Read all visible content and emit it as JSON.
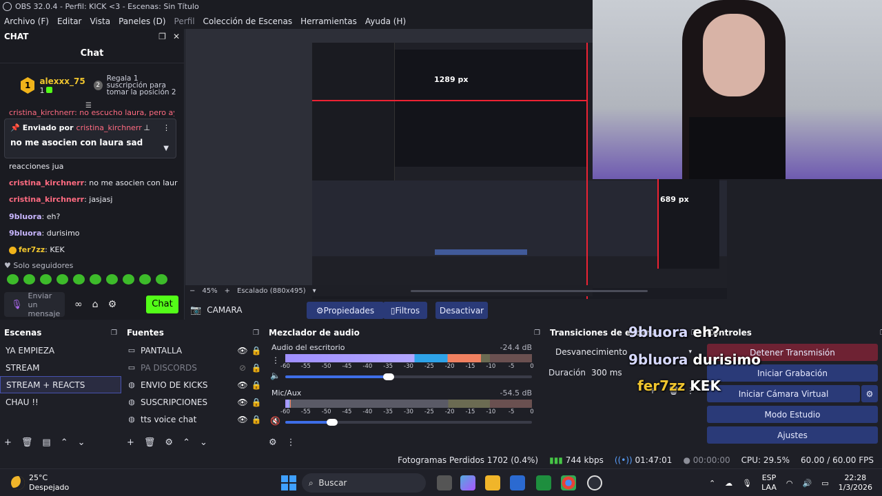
{
  "window": {
    "title": "OBS 32.0.4 - Perfil: KICK <3 - Escenas: Sin Título"
  },
  "menu": [
    "Archivo (F)",
    "Editar",
    "Vista",
    "Paneles (D)",
    "Perfil",
    "Colección de Escenas",
    "Herramientas",
    "Ayuda (H)"
  ],
  "chat": {
    "dock_title": "CHAT",
    "title": "Chat",
    "top_gifter": {
      "rank": "1",
      "name": "alexxx_75",
      "count": "1",
      "gift_rank_badge": "2",
      "gift_text": "Regala 1 suscripción para tomar la posición 2"
    },
    "pinned": {
      "prefix": "Enviado por",
      "user": "cristina_kirchnerr",
      "message": "no me asocien con laura sad"
    },
    "partial_line": "cristina_kirchnerr: no escucho laura, pero ayer",
    "messages": [
      {
        "user": "",
        "text": "reacciones jua",
        "color": "#e8e9ef"
      },
      {
        "user": "cristina_kirchnerr",
        "text": ": no me asocien con laura sad",
        "color": "#ff6b81"
      },
      {
        "user": "cristina_kirchnerr",
        "text": ": jasjasj",
        "color": "#ff6b81"
      },
      {
        "user": "9bluora",
        "text": ": eh?",
        "color": "#c9b6ff"
      },
      {
        "user": "9bluora",
        "text": ": durisimo",
        "color": "#c9b6ff"
      },
      {
        "user": "fer7zz",
        "text": ": KEK",
        "color": "#f0c52e"
      }
    ],
    "followers_only": "Solo seguidores",
    "input_placeholder": "Enviar un mensaje",
    "send_label": "Chat"
  },
  "preview": {
    "px_horizontal": "1289 px",
    "px_vertical": "689 px",
    "zoom": "45%",
    "scaling": "Escalado (880x495)"
  },
  "source_toolbar": {
    "source_name": "CAMARA",
    "properties": "Propiedades",
    "filters": "Filtros",
    "deactivate": "Desactivar"
  },
  "scenes": {
    "title": "Escenas",
    "items": [
      "YA EMPIEZA",
      "STREAM",
      "STREAM + REACTS",
      "CHAU !!"
    ],
    "selected": "STREAM + REACTS"
  },
  "sources": {
    "title": "Fuentes",
    "items": [
      {
        "name": "PANTALLA",
        "icon": "monitor-icon",
        "visible": true
      },
      {
        "name": "PA DISCORDS",
        "icon": "monitor-icon",
        "visible": false
      },
      {
        "name": "ENVIO DE KICKS",
        "icon": "globe-icon",
        "visible": true
      },
      {
        "name": "SUSCRIPCIONES",
        "icon": "globe-icon",
        "visible": true
      },
      {
        "name": "tts voice chat",
        "icon": "globe-icon",
        "visible": true
      }
    ]
  },
  "mixer": {
    "title": "Mezclador de audio",
    "channels": [
      {
        "name": "Audio del escritorio",
        "db": "-24.4 dB",
        "level": 0.72,
        "fader": 0.42,
        "muted": false
      },
      {
        "name": "Mic/Aux",
        "db": "-54.5 dB",
        "level": 0.02,
        "fader": 0.19,
        "muted": true
      }
    ],
    "ticks": [
      "-60",
      "-55",
      "-50",
      "-45",
      "-40",
      "-35",
      "-30",
      "-25",
      "-20",
      "-15",
      "-10",
      "-5",
      "0"
    ]
  },
  "transitions": {
    "title": "Transiciones de escena",
    "type": "Desvanecimiento",
    "duration_label": "Duración",
    "duration": "300 ms"
  },
  "controls": {
    "title": "Controles",
    "stop_stream": "Detener Transmisión",
    "start_record": "Iniciar Grabación",
    "virtual_cam": "Iniciar Cámara Virtual",
    "studio_mode": "Modo Estudio",
    "settings": "Ajustes"
  },
  "overlay": [
    {
      "user": "9bluora",
      "text": "eh?"
    },
    {
      "user": "9bluora",
      "text": "durisimo"
    },
    {
      "user": "fer7zz",
      "text": "KEK"
    }
  ],
  "status": {
    "dropped": "Fotogramas Perdidos 1702 (0.4%)",
    "bitrate": "744 kbps",
    "live_time": "01:47:01",
    "rec_time": "00:00:00",
    "cpu": "CPU: 29.5%",
    "fps": "60.00 / 60.00 FPS"
  },
  "taskbar": {
    "temp": "25°C",
    "weather": "Despejado",
    "search": "Buscar",
    "lang1": "ESP",
    "lang2": "LAA",
    "time": "22:28",
    "date": "1/3/2026"
  },
  "colors": {
    "accent": "#2a3a78",
    "kick_green": "#53fc18",
    "stop_red": "#6e2233"
  }
}
